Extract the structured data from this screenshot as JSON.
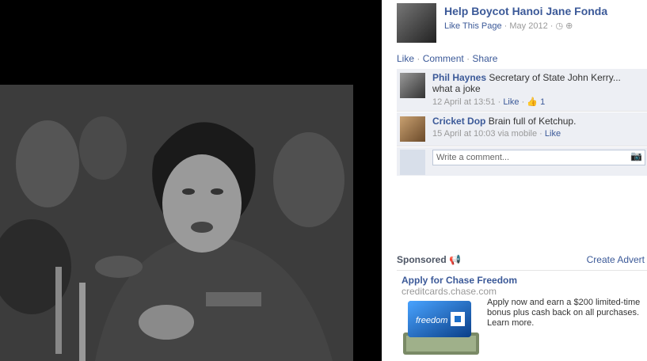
{
  "post": {
    "page_name": "Help Boycot Hanoi Jane Fonda",
    "like_page": "Like This Page",
    "date": "May 2012",
    "actions": {
      "like": "Like",
      "comment": "Comment",
      "share": "Share"
    }
  },
  "comments": [
    {
      "author": "Phil Haynes",
      "text": "Secretary of State John Kerry... what a joke",
      "time": "12 April at 13:51",
      "like": "Like",
      "likes_count": "1"
    },
    {
      "author": "Cricket Dop",
      "text": "Brain full of Ketchup.",
      "time": "15 April at 10:03 via mobile",
      "like": "Like"
    }
  ],
  "write_comment": {
    "placeholder": "Write a comment..."
  },
  "sponsored": {
    "label": "Sponsored",
    "create": "Create Advert",
    "ad": {
      "title": "Apply for Chase Freedom",
      "url": "creditcards.chase.com",
      "text": "Apply now and earn a $200 limited-time bonus plus cash back on all purchases. Learn more.",
      "card_text": "freedom"
    }
  },
  "colors": {
    "link": "#3b5998",
    "comment_bg": "#edeff4"
  }
}
